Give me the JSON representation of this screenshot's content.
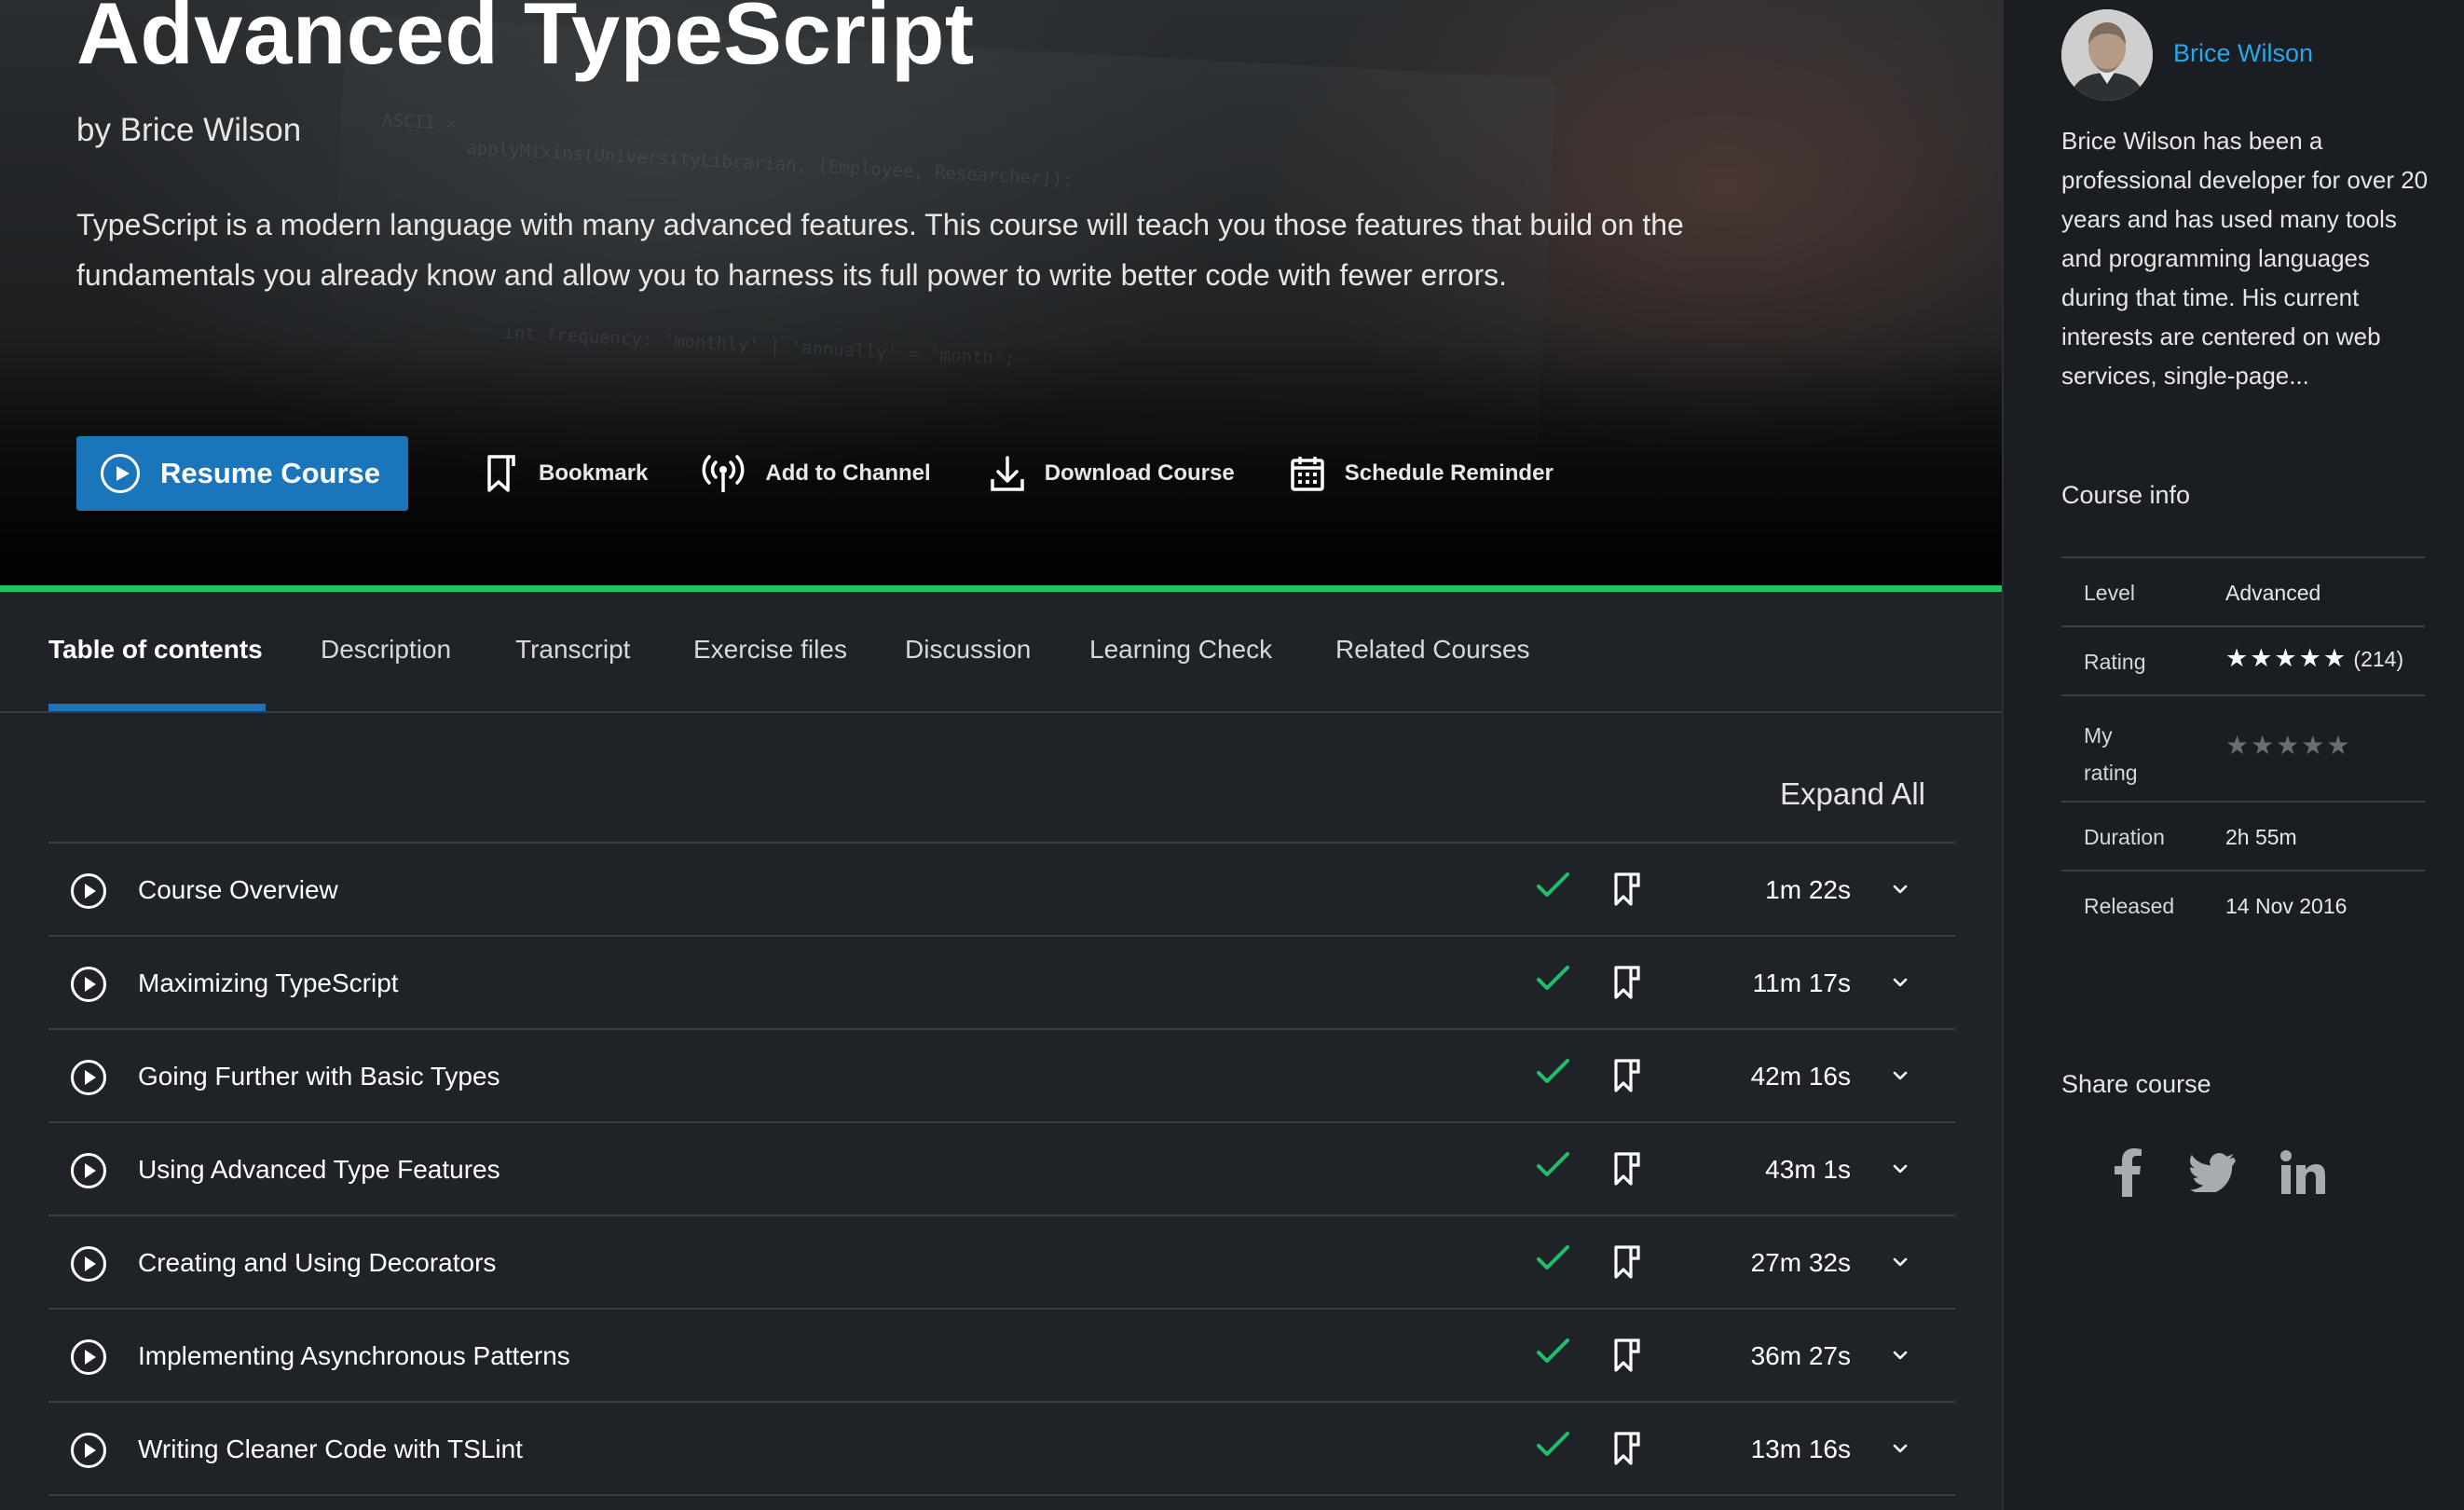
{
  "course": {
    "title": "Advanced TypeScript",
    "author": "by Brice Wilson",
    "description": "TypeScript is a modern language with many advanced features. This course will teach you those features that build on the fundamentals you already know and allow you to harness its full power to write better code with fewer errors."
  },
  "actions": {
    "resume": {
      "label": "Resume Course",
      "icon": "play-circle-icon"
    },
    "bookmark": {
      "label": "Bookmark",
      "icon": "bookmark-icon"
    },
    "channel": {
      "label": "Add to Channel",
      "icon": "broadcast-icon"
    },
    "download": {
      "label": "Download Course",
      "icon": "download-icon"
    },
    "schedule": {
      "label": "Schedule Reminder",
      "icon": "calendar-icon"
    }
  },
  "tabs": [
    {
      "label": "Table of contents",
      "active": true
    },
    {
      "label": "Description"
    },
    {
      "label": "Transcript"
    },
    {
      "label": "Exercise files"
    },
    {
      "label": "Discussion"
    },
    {
      "label": "Learning Check"
    },
    {
      "label": "Related Courses"
    }
  ],
  "toc": {
    "expand_all": "Expand All",
    "modules": [
      {
        "title": "Course Overview",
        "duration": "1m 22s",
        "completed": true
      },
      {
        "title": "Maximizing TypeScript",
        "duration": "11m 17s",
        "completed": true
      },
      {
        "title": "Going Further with Basic Types",
        "duration": "42m 16s",
        "completed": true
      },
      {
        "title": "Using Advanced Type Features",
        "duration": "43m 1s",
        "completed": true
      },
      {
        "title": "Creating and Using Decorators",
        "duration": "27m 32s",
        "completed": true
      },
      {
        "title": "Implementing Asynchronous Patterns",
        "duration": "36m 27s",
        "completed": true
      },
      {
        "title": "Writing Cleaner Code with TSLint",
        "duration": "13m 16s",
        "completed": true
      }
    ]
  },
  "sidebar": {
    "author_name": "Brice Wilson",
    "bio": "Brice Wilson has been a professional developer for over 20 years and has used many tools and programming languages during that time. His current interests are centered on web services, single-page...",
    "course_info_heading": "Course info",
    "info": {
      "level_label": "Level",
      "level": "Advanced",
      "rating_label": "Rating",
      "rating_stars": "★★★★★",
      "rating_count": "(214)",
      "my_rating_label": "My\nrating",
      "my_rating_stars": "★★★★★",
      "duration_label": "Duration",
      "duration": "2h 55m",
      "released_label": "Released",
      "released": "14 Nov 2016"
    },
    "share_heading": "Share course",
    "share_icons": [
      "facebook-icon",
      "twitter-icon",
      "linkedin-icon"
    ]
  },
  "colors": {
    "accent": "#1b75ba",
    "progress_green": "#22c45e",
    "check_green": "#1fbf6a",
    "link": "#2aa7e8"
  }
}
